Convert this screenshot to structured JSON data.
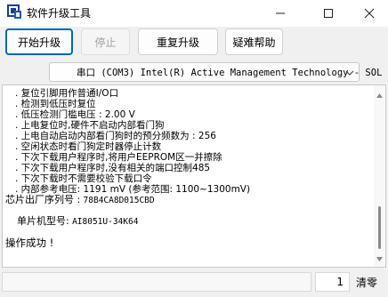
{
  "window": {
    "title": "软件升级工具",
    "controls": [
      "minimize-icon",
      "maximize-icon",
      "close-icon"
    ]
  },
  "toolbar": {
    "start_label": "开始升级",
    "stop_label": "停止",
    "retry_label": "重复升级",
    "help_label": "疑难帮助"
  },
  "port": {
    "selected": "串口 (COM3) Intel(R) Active Management Technology - SOL"
  },
  "log": {
    "option_lines": [
      ". 复位引脚用作普通I/O口",
      ". 检测到低压时复位",
      ". 低压检测门槛电压 : 2.00 V",
      ". 上电复位时,硬件不启动内部看门狗",
      ". 上电自动启动内部看门狗时的预分频数为 : 256",
      ". 空闲状态时看门狗定时器停止计数",
      ". 下次下载用户程序时,将用户EEPROM区一并擦除",
      ". 下次下载用户程序时,没有相关的端口控制485",
      ". 下次下载时不需要校验下载口令",
      ". 内部参考电压: 1191 mV (参考范围: 1100~1300mV)"
    ],
    "chip_serial_label": "芯片出厂序列号 :",
    "chip_serial_value": "78B4CA8D015CBD",
    "chip_model_label": "单片机型号:",
    "chip_model_value": "AI8051U-34K64",
    "result": "操作成功 !"
  },
  "status": {
    "page_number": "1",
    "clear_label": "清零"
  },
  "colors": {
    "accent": "#0067c0",
    "window_bg": "#f0f0f0",
    "log_bg": "#ffffff",
    "scroll_thumb": "#8a8a8a"
  }
}
